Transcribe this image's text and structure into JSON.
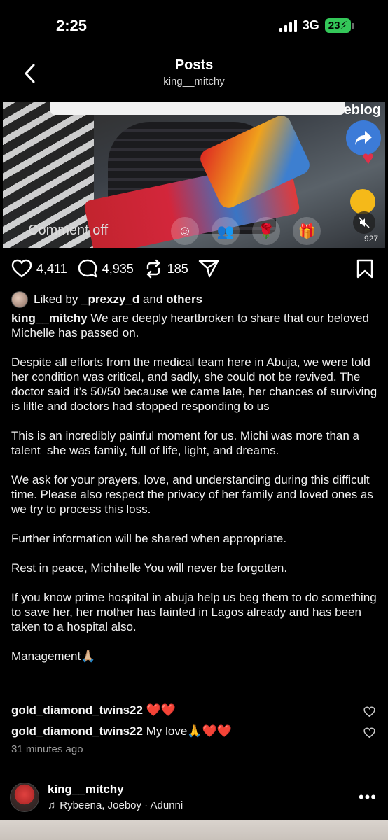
{
  "status_bar": {
    "time": "2:25",
    "network": "3G",
    "battery": "23"
  },
  "header": {
    "title": "Posts",
    "username": "king__mitchy"
  },
  "media": {
    "overlay_text": "eblog",
    "comment_status": "Comment off",
    "count": "927"
  },
  "actions": {
    "likes": "4,411",
    "comments": "4,935",
    "reposts": "185"
  },
  "liked_by": {
    "prefix": "Liked by",
    "user": "_prexzy_d",
    "and": "and",
    "others": "others"
  },
  "caption": {
    "username": "king__mitchy",
    "paragraphs": [
      "We are deeply heartbroken to share that our beloved Michelle has passed on.",
      "Despite all efforts from the medical team here in Abuja, we were told her condition was critical, and sadly, she could not be revived. The doctor said it’s 50/50 because we came late, her chances of surviving is liltle and doctors had stopped responding to us",
      "This is an incredibly painful moment for us. Michi was more than a talent  she was family, full of life, light, and dreams.",
      "We ask for your prayers, love, and understanding during this difficult time. Please also respect the privacy of her family and loved ones as we try to process this loss.",
      "Further information will be shared when appropriate.",
      "Rest in peace, Michhelle You will never be forgotten.",
      "If you know prime hospital in abuja help us beg them to do something to save her, her mother has fainted in Lagos already and has been taken to a hospital also.",
      "Management🙏🏼"
    ]
  },
  "comments": [
    {
      "user": "gold_diamond_twins22",
      "text": "❤️❤️"
    },
    {
      "user": "gold_diamond_twins22",
      "text": "My love🙏❤️❤️"
    }
  ],
  "time_ago": "31 minutes ago",
  "next_post": {
    "username": "king__mitchy",
    "music": "Rybeena, Joeboy · Adunni"
  }
}
